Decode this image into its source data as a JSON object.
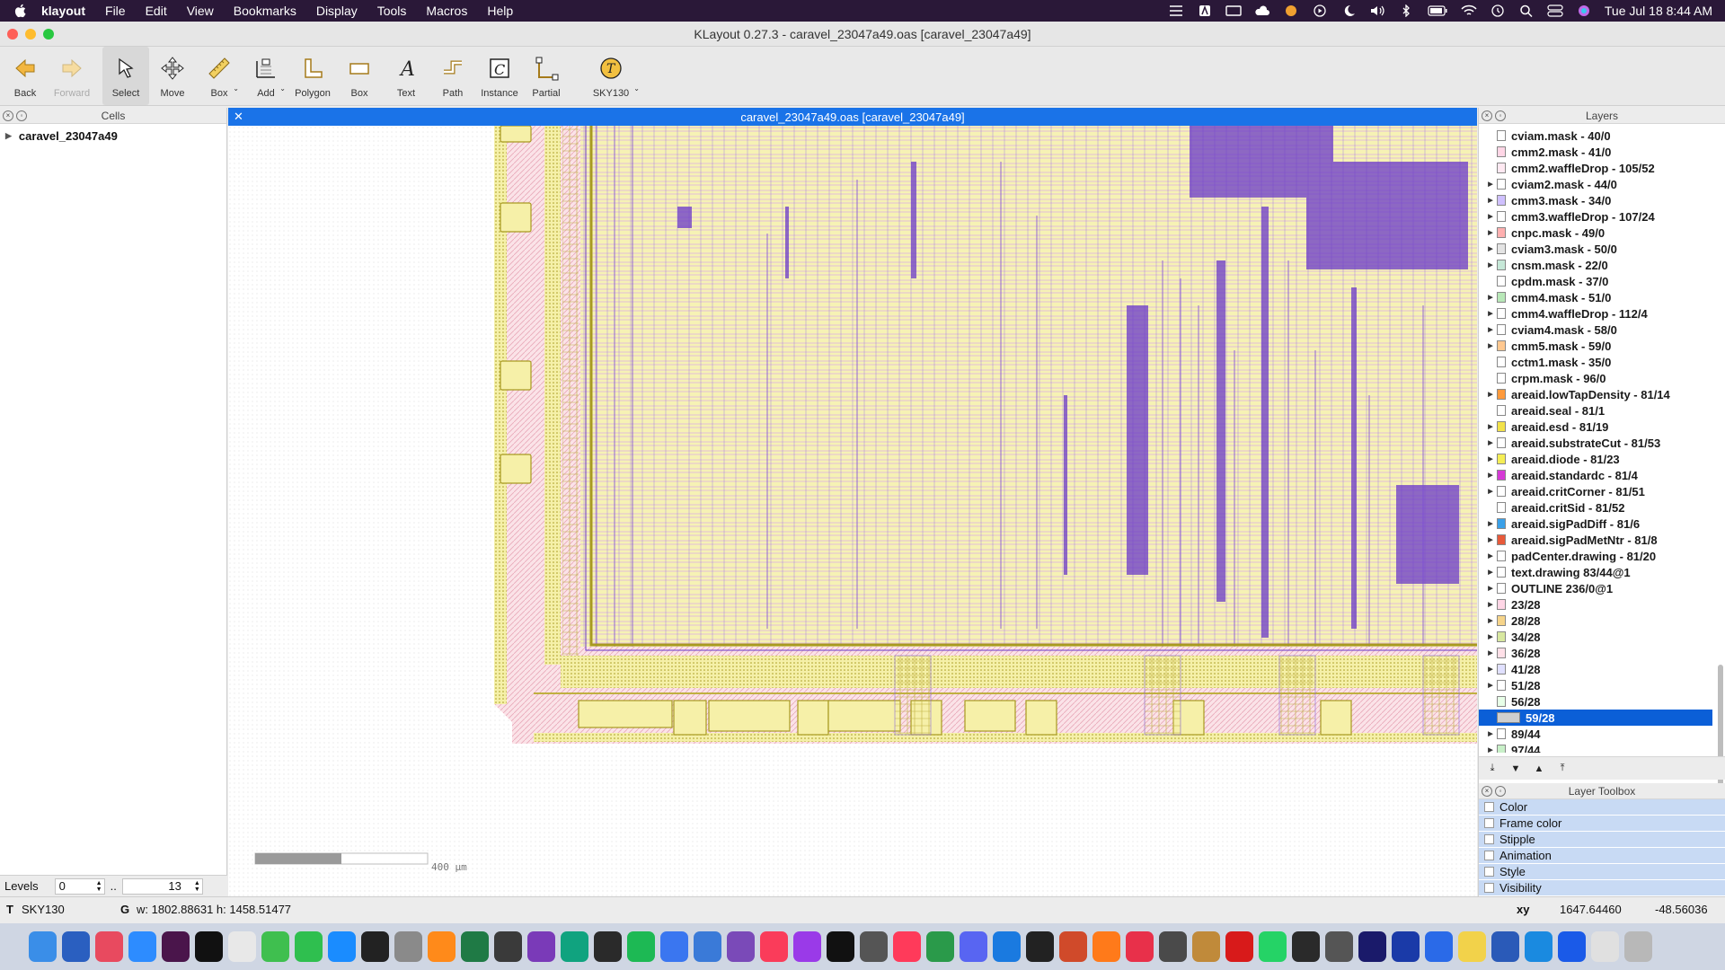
{
  "menubar": {
    "app_name": "klayout",
    "items": [
      "File",
      "Edit",
      "View",
      "Bookmarks",
      "Display",
      "Tools",
      "Macros",
      "Help"
    ],
    "clock": "Tue Jul 18  8:44 AM"
  },
  "window": {
    "title": "KLayout 0.27.3 - caravel_23047a49.oas [caravel_23047a49]"
  },
  "toolbar": {
    "back": "Back",
    "forward": "Forward",
    "select": "Select",
    "move": "Move",
    "box_ruler": "Box",
    "add": "Add",
    "polygon": "Polygon",
    "box": "Box",
    "text": "Text",
    "path": "Path",
    "instance": "Instance",
    "partial": "Partial",
    "tech": "SKY130"
  },
  "cells": {
    "title": "Cells",
    "top_cell": "caravel_23047a49",
    "levels_label": "Levels",
    "level_from": "0",
    "level_sep": "..",
    "level_to": "13"
  },
  "view": {
    "tab_title": "caravel_23047a49.oas [caravel_23047a49]",
    "scale_label": "400 µm"
  },
  "layers": {
    "title": "Layers",
    "items": [
      {
        "name": "cviam.mask - 40/0",
        "color": "#ffffff",
        "tri": false
      },
      {
        "name": "cmm2.mask - 41/0",
        "color": "#ffd6e6",
        "tri": false
      },
      {
        "name": "cmm2.waffleDrop - 105/52",
        "color": "#ffe9f2",
        "tri": false
      },
      {
        "name": "cviam2.mask - 44/0",
        "color": "#ffffff",
        "tri": true
      },
      {
        "name": "cmm3.mask - 34/0",
        "color": "#cfc0ff",
        "tri": true
      },
      {
        "name": "cmm3.waffleDrop - 107/24",
        "color": "#ffffff",
        "tri": true
      },
      {
        "name": "cnpc.mask - 49/0",
        "color": "#ffb0b0",
        "tri": true
      },
      {
        "name": "cviam3.mask - 50/0",
        "color": "#e4e4e4",
        "tri": true
      },
      {
        "name": "cnsm.mask - 22/0",
        "color": "#c6e8d8",
        "tri": true
      },
      {
        "name": "cpdm.mask - 37/0",
        "color": "#ffffff",
        "tri": false
      },
      {
        "name": "cmm4.mask - 51/0",
        "color": "#b8e8b8",
        "tri": true
      },
      {
        "name": "cmm4.waffleDrop - 112/4",
        "color": "#ffffff",
        "tri": true
      },
      {
        "name": "cviam4.mask - 58/0",
        "color": "#ffffff",
        "tri": true
      },
      {
        "name": "cmm5.mask - 59/0",
        "color": "#ffc890",
        "tri": true
      },
      {
        "name": "cctm1.mask - 35/0",
        "color": "#ffffff",
        "tri": false
      },
      {
        "name": "crpm.mask - 96/0",
        "color": "#ffffff",
        "tri": false
      },
      {
        "name": "areaid.lowTapDensity - 81/14",
        "color": "#ff9a3c",
        "tri": true
      },
      {
        "name": "areaid.seal - 81/1",
        "color": "#ffffff",
        "tri": false
      },
      {
        "name": "areaid.esd - 81/19",
        "color": "#f2e24a",
        "tri": true
      },
      {
        "name": "areaid.substrateCut - 81/53",
        "color": "#ffffff",
        "tri": true
      },
      {
        "name": "areaid.diode - 81/23",
        "color": "#f5ee55",
        "tri": true
      },
      {
        "name": "areaid.standardc - 81/4",
        "color": "#d63ad6",
        "tri": true
      },
      {
        "name": "areaid.critCorner - 81/51",
        "color": "#ffffff",
        "tri": true
      },
      {
        "name": "areaid.critSid - 81/52",
        "color": "#ffffff",
        "tri": false
      },
      {
        "name": "areaid.sigPadDiff - 81/6",
        "color": "#3aa0e8",
        "tri": true
      },
      {
        "name": "areaid.sigPadMetNtr - 81/8",
        "color": "#e85a3a",
        "tri": true
      },
      {
        "name": "padCenter.drawing - 81/20",
        "color": "#ffffff",
        "tri": true
      },
      {
        "name": "text.drawing 83/44@1",
        "color": "#ffffff",
        "tri": true
      },
      {
        "name": "OUTLINE 236/0@1",
        "color": "#ffffff",
        "tri": true
      },
      {
        "name": "23/28",
        "color": "#ffd6e6",
        "tri": true
      },
      {
        "name": "28/28",
        "color": "#f6d48a",
        "tri": true
      },
      {
        "name": "34/28",
        "color": "#d8e8a0",
        "tri": true
      },
      {
        "name": "36/28",
        "color": "#ffe0e8",
        "tri": true
      },
      {
        "name": "41/28",
        "color": "#e0e0ff",
        "tri": true
      },
      {
        "name": "51/28",
        "color": "#ffffff",
        "tri": true
      },
      {
        "name": "56/28",
        "color": "#e8ffe8",
        "tri": false
      },
      {
        "name": "59/28",
        "color": "#cfcfcf",
        "tri": false,
        "selected": true
      },
      {
        "name": "89/44",
        "color": "#ffffff",
        "tri": true
      },
      {
        "name": "97/44",
        "color": "#c8f0c8",
        "tri": true
      }
    ]
  },
  "toolbox": {
    "title": "Layer Toolbox",
    "items": [
      "Color",
      "Frame color",
      "Stipple",
      "Animation",
      "Style",
      "Visibility"
    ]
  },
  "status": {
    "tech_prefix": "T",
    "tech": "SKY130",
    "grid_prefix": "G",
    "dimensions": "w: 1802.88631  h: 1458.51477",
    "coord_label": "xy",
    "x": "1647.64460",
    "y": "-48.56036"
  },
  "dock": {
    "icons": [
      "finder-icon",
      "word-icon",
      "launchpad-icon",
      "zoom-icon",
      "slack-icon",
      "pycharm-icon",
      "chrome-icon",
      "messages-icon",
      "facetime-icon",
      "appstore-icon",
      "terminal-icon",
      "settings-icon",
      "books-icon",
      "excel-icon",
      "klayout-icon",
      "onenote-icon",
      "chatgpt-icon",
      "activity-icon",
      "spotify-icon",
      "signal-icon",
      "chat-icon",
      "tor-icon",
      "music-icon",
      "podcasts-icon",
      "tv-icon",
      "calculator-icon",
      "news-icon",
      "webex-icon",
      "discord-icon",
      "vscode-icon",
      "github-icon",
      "powerpoint-icon",
      "firefox-icon",
      "opera-icon",
      "xquartz-icon",
      "magic-icon",
      "acrobat-icon",
      "whatsapp-icon",
      "gtk-icon",
      "typora-icon",
      "premiere-icon",
      "photoshop-icon",
      "docs-icon",
      "notes-icon",
      "word2-icon",
      "xcode-icon",
      "list-icon",
      "mail-icon",
      "trash-icon"
    ],
    "colors": [
      "#3a8ee8",
      "#2a5fc0",
      "#e84a5f",
      "#2d8cff",
      "#4a154b",
      "#111111",
      "#e8e8e8",
      "#3fbf4f",
      "#2fbf4f",
      "#1a8cff",
      "#222222",
      "#8a8a8a",
      "#ff8a1a",
      "#1f7a45",
      "#3a3a3a",
      "#7a3ab8",
      "#10a37f",
      "#2a2a2a",
      "#1db954",
      "#3a76f0",
      "#3a7ad8",
      "#7a4ab8",
      "#fa3c5a",
      "#9a3ae8",
      "#111111",
      "#555555",
      "#ff3a5a",
      "#2a9a4a",
      "#5865f2",
      "#1a7ae0",
      "#222222",
      "#d04a2a",
      "#ff7a1a",
      "#e8304a",
      "#4a4a4a",
      "#c08a3a",
      "#d81a1a",
      "#25d366",
      "#2a2a2a",
      "#555555",
      "#1a1a6a",
      "#1a3aa8",
      "#2a6ae8",
      "#f2d24a",
      "#2a5ab8",
      "#1a8ae0",
      "#1a5ae8",
      "#e0e0e0",
      "#b8b8b8"
    ]
  }
}
